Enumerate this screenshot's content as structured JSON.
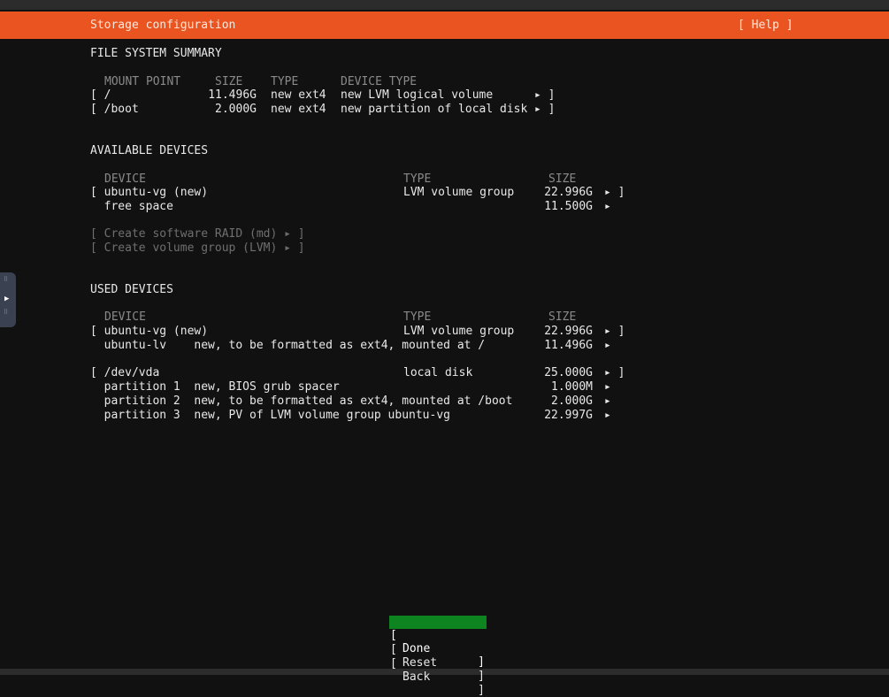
{
  "header": {
    "title": "Storage configuration",
    "help": "[ Help ]"
  },
  "fs_summary": {
    "heading": "FILE SYSTEM SUMMARY",
    "col_mount": "MOUNT POINT",
    "col_size": "SIZE",
    "col_type": "TYPE",
    "col_devtype": "DEVICE TYPE",
    "rows": [
      {
        "mount": "[ /",
        "size": "11.496G",
        "type": "new ext4",
        "devtype": "new LVM logical volume",
        "end": "▸ ]"
      },
      {
        "mount": "[ /boot",
        "size": "2.000G",
        "type": "new ext4",
        "devtype": "new partition of local disk",
        "end": "▸ ]"
      }
    ]
  },
  "available": {
    "heading": "AVAILABLE DEVICES",
    "col_device": "DEVICE",
    "col_type": "TYPE",
    "col_size": "SIZE",
    "rows": [
      {
        "device": "[ ubuntu-vg (new)",
        "type": "LVM volume group",
        "size": "22.996G",
        "end": "▸ ]"
      },
      {
        "device": "  free space",
        "type": "",
        "size": "11.500G",
        "end": "▸"
      }
    ],
    "create_raid": "[ Create software RAID (md) ▸ ]",
    "create_vg": "[ Create volume group (LVM) ▸ ]"
  },
  "used": {
    "heading": "USED DEVICES",
    "col_device": "DEVICE",
    "col_type": "TYPE",
    "col_size": "SIZE",
    "rows": [
      {
        "device": "[ ubuntu-vg (new)",
        "type": "LVM volume group",
        "size": "22.996G",
        "end": "▸ ]"
      },
      {
        "device": "  ubuntu-lv    new, to be formatted as ext4, mounted at /",
        "type": "",
        "size": "11.496G",
        "end": "▸"
      },
      {
        "device": "[ /dev/vda",
        "type": "local disk",
        "size": "25.000G",
        "end": "▸ ]"
      },
      {
        "device": "  partition 1  new, BIOS grub spacer",
        "type": "",
        "size": "1.000M",
        "end": "▸"
      },
      {
        "device": "  partition 2  new, to be formatted as ext4, mounted at /boot",
        "type": "",
        "size": "2.000G",
        "end": "▸"
      },
      {
        "device": "  partition 3  new, PV of LVM volume group ubuntu-vg",
        "type": "",
        "size": "22.997G",
        "end": "▸"
      }
    ]
  },
  "buttons": {
    "open": "[",
    "close": "]",
    "done": "Done",
    "reset": "Reset",
    "back": "Back"
  }
}
